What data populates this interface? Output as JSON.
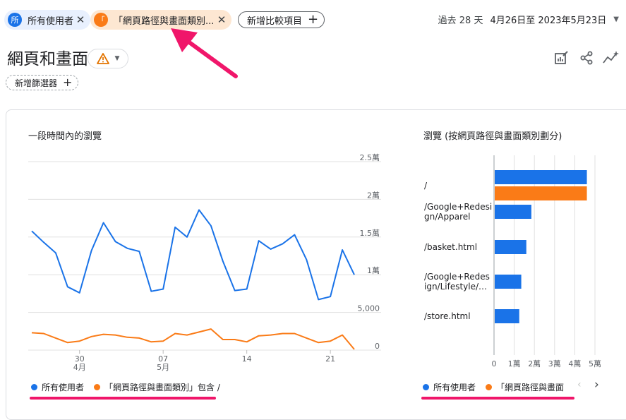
{
  "header": {
    "segments": [
      {
        "badge": "所",
        "label": "所有使用者",
        "color": "#1a73e8"
      },
      {
        "badge": "「",
        "label": "「網頁路徑與畫面類別...",
        "color": "#fa7b17"
      }
    ],
    "add_comparison": "新增比較項目",
    "date_prefix": "過去 28 天",
    "date_range": "4月26日至 2023年5月23日"
  },
  "page": {
    "title": "網頁和畫面",
    "add_filter": "新增篩選器"
  },
  "line_chart": {
    "title": "一段時間內的瀏覽",
    "y_ticks": [
      "2.5萬",
      "2萬",
      "1.5萬",
      "1萬",
      "5,000",
      "0"
    ],
    "x_ticks": [
      {
        "day": "30",
        "month": "4月"
      },
      {
        "day": "07",
        "month": "5月"
      },
      {
        "day": "14",
        "month": ""
      },
      {
        "day": "21",
        "month": ""
      }
    ],
    "legend": [
      {
        "label": "所有使用者",
        "color": "#1a73e8"
      },
      {
        "label": "「網頁路徑與畫面類別」包含 /",
        "color": "#fa7b17"
      }
    ]
  },
  "bar_chart": {
    "title": "瀏覽 (按網頁路徑與畫面類別劃分)",
    "x_ticks": [
      "0",
      "1萬",
      "2萬",
      "3萬",
      "4萬",
      "5萬"
    ],
    "legend": [
      {
        "label": "所有使用者",
        "color": "#1a73e8"
      },
      {
        "label": "「網頁路徑與畫面",
        "color": "#fa7b17"
      }
    ]
  },
  "chart_data": [
    {
      "type": "line",
      "title": "一段時間內的瀏覽",
      "x": [
        "04-26",
        "04-27",
        "04-28",
        "04-29",
        "04-30",
        "05-01",
        "05-02",
        "05-03",
        "05-04",
        "05-05",
        "05-06",
        "05-07",
        "05-08",
        "05-09",
        "05-10",
        "05-11",
        "05-12",
        "05-13",
        "05-14",
        "05-15",
        "05-16",
        "05-17",
        "05-18",
        "05-19",
        "05-20",
        "05-21",
        "05-22",
        "05-23"
      ],
      "ylim": [
        0,
        25000
      ],
      "series": [
        {
          "name": "所有使用者",
          "color": "#1a73e8",
          "values": [
            15800,
            14300,
            12900,
            8400,
            7600,
            13200,
            16900,
            14400,
            13500,
            13100,
            7800,
            8100,
            16300,
            15000,
            18600,
            16500,
            11800,
            7900,
            8100,
            14500,
            13400,
            14100,
            15300,
            12000,
            6700,
            7100,
            13300,
            10000
          ]
        },
        {
          "name": "「網頁路徑與畫面類別」包含 /",
          "color": "#fa7b17",
          "values": [
            2300,
            2200,
            1600,
            1000,
            1200,
            1800,
            2100,
            2000,
            1700,
            1600,
            1100,
            1200,
            2200,
            2000,
            2400,
            2800,
            1400,
            1400,
            1100,
            1900,
            2000,
            2200,
            2200,
            1600,
            1000,
            1200,
            2000,
            100
          ]
        }
      ]
    },
    {
      "type": "bar",
      "title": "瀏覽 (按網頁路徑與畫面類別劃分)",
      "categories": [
        "/",
        "/Google+Redesign/Apparel",
        "/basket.html",
        "/Google+Redesign/Lifestyle/…",
        "/store.html"
      ],
      "category_labels": [
        [
          "/"
        ],
        [
          "/Google+Redesi",
          "gn/Apparel"
        ],
        [
          "/basket.html"
        ],
        [
          "/Google+Redes",
          "ign/Lifestyle/…"
        ],
        [
          "/store.html"
        ]
      ],
      "xlim": [
        0,
        50000
      ],
      "series": [
        {
          "name": "所有使用者",
          "color": "#1a73e8",
          "values": [
            46000,
            18500,
            16000,
            13500,
            12500
          ]
        },
        {
          "name": "「網頁路徑與畫面類別」包含 /",
          "color": "#fa7b17",
          "values": [
            46000,
            0,
            0,
            0,
            0
          ]
        }
      ]
    }
  ]
}
